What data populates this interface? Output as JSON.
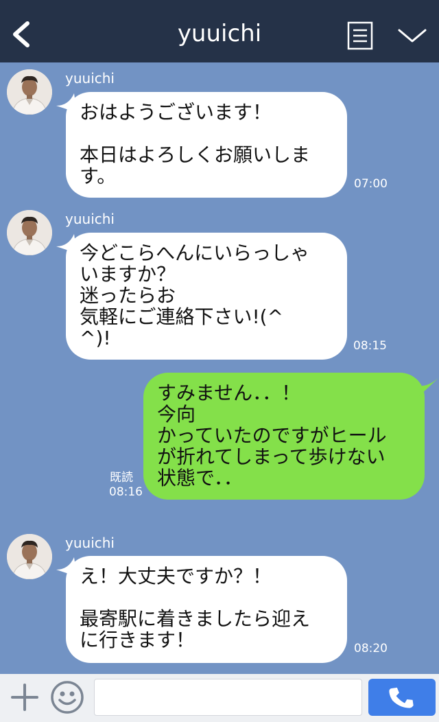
{
  "header": {
    "title": "yuuichi",
    "back_icon": "chevron-left-icon",
    "menu_icon": "menu-list-icon",
    "expand_icon": "chevron-down-icon"
  },
  "messages": [
    {
      "sender": "yuuichi",
      "text": "おはようございます！\n\n本日はよろしくお願いしま\nす。",
      "time": "07:00"
    },
    {
      "sender": "yuuichi",
      "text": "今どこらへんにいらっしゃ\nいますか？\n迷ったらお\n気軽にご連絡下さい!(^\n^)!",
      "time": "08:15"
    },
    {
      "text": "すみません．．！\n今向\nかっていたのですがヒール\nが折れてしまって歩けない\n状態で．．",
      "read_label": "既読",
      "time": "08:16"
    },
    {
      "sender": "yuuichi",
      "text": "え！大丈夫ですか？！\n\n最寄駅に着きましたら迎え\nに行きます！",
      "time": "08:20"
    }
  ],
  "composer": {
    "input_value": "",
    "plus_icon": "plus-icon",
    "emoji_icon": "smiley-icon",
    "call_icon": "phone-icon"
  },
  "colors": {
    "header": "#253248",
    "background": "#7293c4",
    "incoming_bubble": "#ffffff",
    "outgoing_bubble": "#84e04a",
    "call_button": "#3f7ee8"
  }
}
